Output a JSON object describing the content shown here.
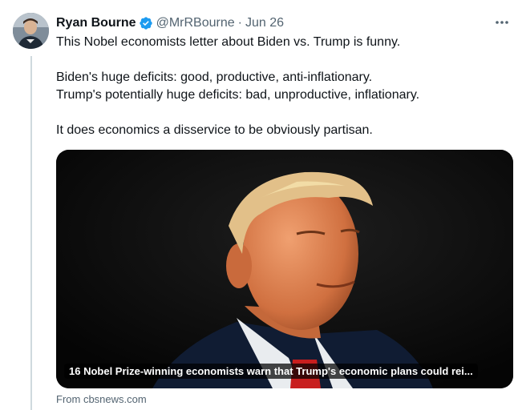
{
  "tweet": {
    "author_name": "Ryan Bourne",
    "handle": "@MrRBourne",
    "separator": "·",
    "date": "Jun 26",
    "verified_color": "#1d9bf0",
    "lines": [
      "This Nobel economists letter about Biden vs. Trump is funny.",
      "Biden's huge deficits: good, productive, anti-inflationary.",
      "Trump's potentially huge deficits: bad, unproductive, inflationary.",
      "It does economics a disservice to be obviously partisan."
    ]
  },
  "card": {
    "title": "16 Nobel Prize-winning economists warn that Trump's economic plans could rei...",
    "source": "From cbsnews.com"
  },
  "icons": {
    "verified": "verified-badge-icon",
    "more": "more-dots-icon"
  }
}
